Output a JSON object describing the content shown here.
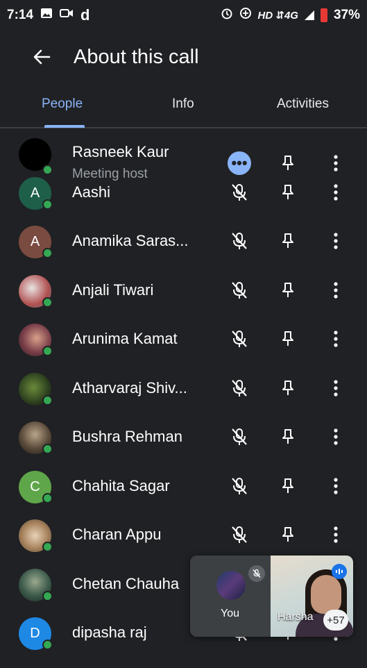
{
  "status_bar": {
    "time": "7:14",
    "left_icons": [
      "image-icon",
      "video-call-icon",
      "d-app-icon"
    ],
    "right_icons": [
      "alarm-icon",
      "data-saver-icon"
    ],
    "network": "HD ⇵4G",
    "battery": "37%"
  },
  "header": {
    "title": "About this call"
  },
  "tabs": [
    {
      "label": "People",
      "active": true
    },
    {
      "label": "Info",
      "active": false
    },
    {
      "label": "Activities",
      "active": false
    }
  ],
  "participants": [
    {
      "name": "Rasneek Kaur",
      "subtitle": "Meeting host",
      "avatar_letter": "",
      "avatar_color": "#000000",
      "state": "more-options"
    },
    {
      "name": "Aashi",
      "avatar_letter": "A",
      "avatar_color": "#1e5f4a",
      "state": "muted"
    },
    {
      "name": "Anamika Saras...",
      "avatar_letter": "A",
      "avatar_color": "#7a4b40",
      "state": "muted"
    },
    {
      "name": "Anjali Tiwari",
      "avatar_letter": "",
      "avatar_color": "#b8a6a6",
      "state": "muted"
    },
    {
      "name": "Arunima Kamat",
      "avatar_letter": "",
      "avatar_color": "#9c6b6b",
      "state": "muted"
    },
    {
      "name": "Atharvaraj Shiv...",
      "avatar_letter": "",
      "avatar_color": "#3c5a2a",
      "state": "muted"
    },
    {
      "name": "Bushra Rehman",
      "avatar_letter": "",
      "avatar_color": "#6b5a45",
      "state": "muted"
    },
    {
      "name": "Chahita Sagar",
      "avatar_letter": "C",
      "avatar_color": "#5fa64a",
      "state": "muted"
    },
    {
      "name": "Charan Appu",
      "avatar_letter": "",
      "avatar_color": "#c9b08e",
      "state": "muted"
    },
    {
      "name": "Chetan Chauha",
      "avatar_letter": "",
      "avatar_color": "#4b6b5c",
      "state": "muted"
    },
    {
      "name": "dipasha raj",
      "avatar_letter": "D",
      "avatar_color": "#1e88e5",
      "state": "muted"
    }
  ],
  "floating_tiles": {
    "self_label": "You",
    "speaker_name": "Harsha",
    "overflow_count": "+57"
  },
  "colors": {
    "accent": "#8ab4f8",
    "background": "#202124",
    "presence": "#34a853"
  }
}
